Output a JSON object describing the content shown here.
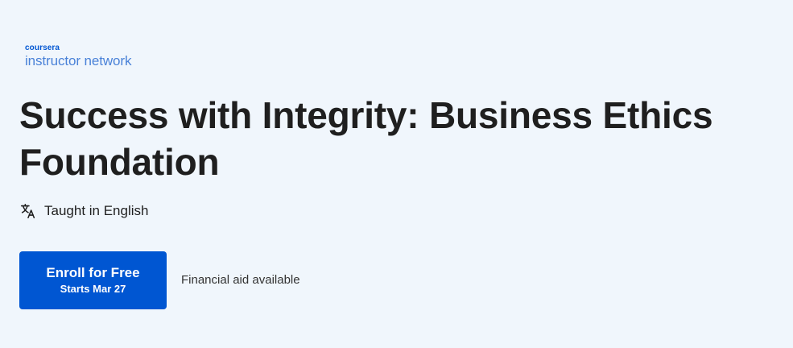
{
  "brand": {
    "top": "coursera",
    "bottom": "instructor network"
  },
  "course": {
    "title": "Success with Integrity: Business Ethics Foundation",
    "language": "Taught in English",
    "language_icon": "translate-icon"
  },
  "cta": {
    "enroll_label": "Enroll for Free",
    "starts_label": "Starts Mar 27",
    "financial_aid": "Financial aid available",
    "button_color": "#0056d2"
  },
  "colors": {
    "background": "#f0f6fc",
    "brand_blue": "#0056d2",
    "text": "#1f1f1f"
  }
}
